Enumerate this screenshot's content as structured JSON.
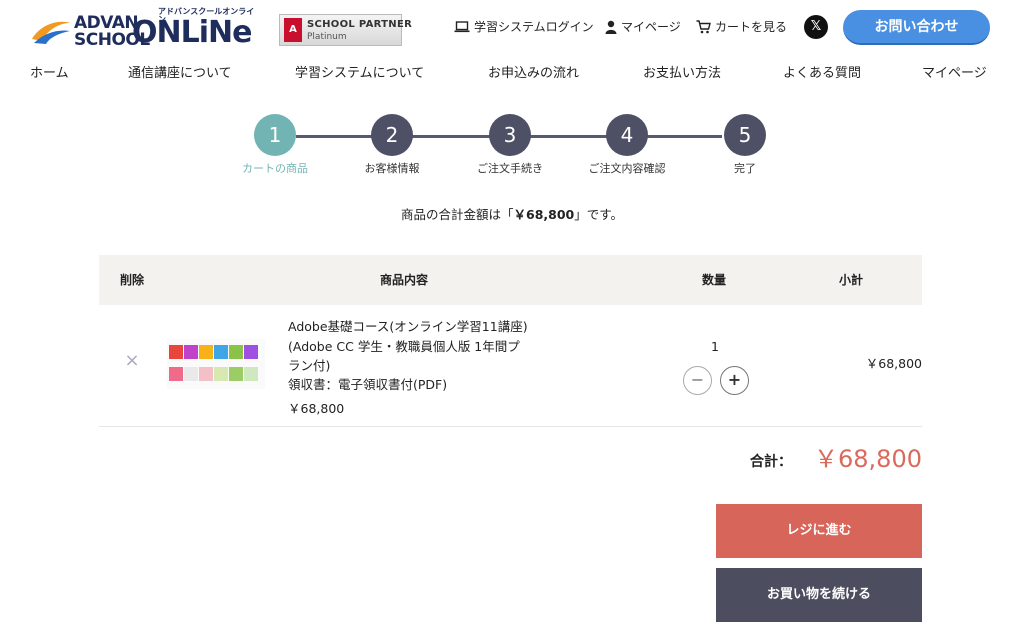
{
  "header": {
    "logo_advan": "ADVAN",
    "logo_school": "SCHOOL",
    "logo_online": "ONLiNe",
    "logo_kana": "アドバンスクールオンライン",
    "partner_mark": "A",
    "partner_title": "SCHOOL PARTNER",
    "partner_sub": "Platinum",
    "util_links": [
      {
        "label": "学習システムログイン",
        "icon": "laptop-icon"
      },
      {
        "label": "マイページ",
        "icon": "user-icon"
      },
      {
        "label": "カートを見る",
        "icon": "cart-icon"
      }
    ],
    "x_label": "𝕏",
    "contact_label": "お問い合わせ"
  },
  "nav": {
    "items": [
      "ホーム",
      "通信講座について",
      "学習システムについて",
      "お申込みの流れ",
      "お支払い方法",
      "よくある質問",
      "マイページ"
    ]
  },
  "steps": [
    {
      "num": "1",
      "label": "カートの商品",
      "active": true
    },
    {
      "num": "2",
      "label": "お客様情報",
      "active": false
    },
    {
      "num": "3",
      "label": "ご注文手続き",
      "active": false
    },
    {
      "num": "4",
      "label": "ご注文内容確認",
      "active": false
    },
    {
      "num": "5",
      "label": "完了",
      "active": false
    }
  ],
  "total_message": {
    "prefix": "商品の合計金額は「",
    "amount": "￥68,800",
    "suffix": "」です。"
  },
  "table": {
    "headers": {
      "remove": "削除",
      "item": "商品内容",
      "qty": "数量",
      "subtotal": "小計"
    },
    "rows": [
      {
        "remove": "×",
        "name": "Adobe基礎コース(オンライン学習11講座)(Adobe CC 学生・教職員個人版 1年間プラン付)",
        "option": "領収書：電子領収書付(PDF)",
        "price": "￥68,800",
        "qty": "1",
        "minus": "−",
        "plus": "+",
        "subtotal": "￥68,800"
      }
    ]
  },
  "summary": {
    "label": "合計：",
    "value": "￥68,800"
  },
  "buttons": {
    "checkout": "レジに進む",
    "continue": "お買い物を続ける"
  },
  "colors": {
    "accent_step": "#72b4b4",
    "step_default": "#4e5165",
    "checkout": "#d8655a",
    "continue": "#4c4d5f",
    "total": "#d96a5c",
    "contact": "#4a90e2"
  }
}
